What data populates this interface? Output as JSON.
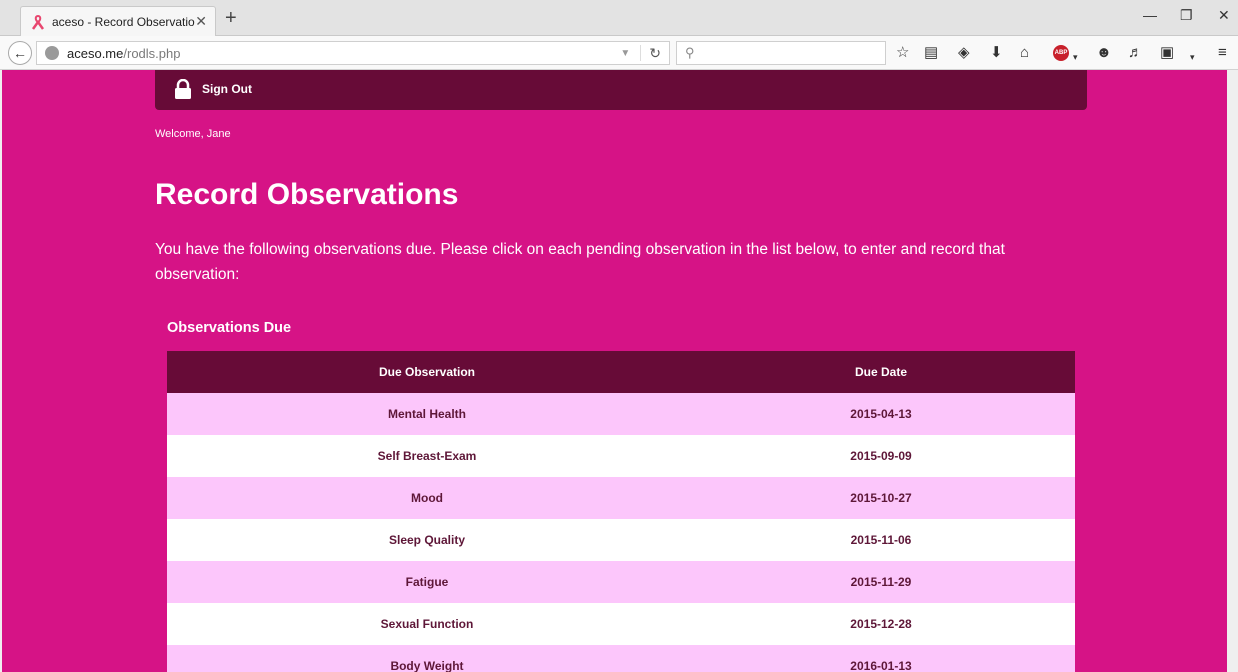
{
  "browser": {
    "tab_title": "aceso - Record Observatio...",
    "url_host": "aceso.me",
    "url_path": "/rodls.php"
  },
  "nav": {
    "signout_label": "Sign Out"
  },
  "welcome": "Welcome, Jane",
  "page_title": "Record Observations",
  "intro": "You have the following observations due. Please click on each pending observation in the list below, to enter and record that observation:",
  "section_title": "Observations Due",
  "table": {
    "headers": [
      "Due Observation",
      "Due Date"
    ],
    "rows": [
      {
        "observation": "Mental Health",
        "date": "2015-04-13"
      },
      {
        "observation": "Self Breast-Exam",
        "date": "2015-09-09"
      },
      {
        "observation": "Mood",
        "date": "2015-10-27"
      },
      {
        "observation": "Sleep Quality",
        "date": "2015-11-06"
      },
      {
        "observation": "Fatigue",
        "date": "2015-11-29"
      },
      {
        "observation": "Sexual Function",
        "date": "2015-12-28"
      },
      {
        "observation": "Body Weight",
        "date": "2016-01-13"
      }
    ]
  },
  "colors": {
    "page_bg": "#d61386",
    "nav_bg": "#670b37",
    "row_alt": "#fcc6fb"
  },
  "icons": [
    "ribbon-icon",
    "lock-icon",
    "back-icon",
    "reload-icon",
    "search-icon",
    "bookmark-star-icon",
    "reading-list-icon",
    "pocket-icon",
    "download-icon",
    "home-icon",
    "adblock-icon",
    "chat-icon",
    "extension-icon",
    "screenshot-icon",
    "menu-icon"
  ]
}
